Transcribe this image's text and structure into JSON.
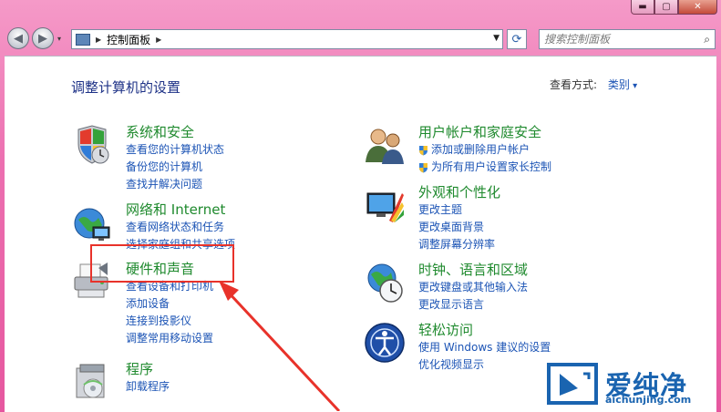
{
  "window": {
    "caption_min": "▬",
    "caption_max": "▢",
    "caption_close": "✕"
  },
  "nav": {
    "back_glyph": "◀",
    "forward_glyph": "▶",
    "breadcrumb": "控制面板",
    "search_placeholder": "搜索控制面板",
    "refresh_glyph": "⟳",
    "search_glyph": "⌕"
  },
  "content": {
    "title": "调整计算机的设置",
    "view_by_label": "查看方式:",
    "view_by_value": "类别"
  },
  "categories": [
    {
      "title": "系统和安全",
      "icon": "system-security-icon",
      "links": [
        "查看您的计算机状态",
        "备份您的计算机",
        "查找并解决问题"
      ]
    },
    {
      "title": "网络和 Internet",
      "icon": "network-icon",
      "links": [
        "查看网络状态和任务",
        "选择家庭组和共享选项"
      ]
    },
    {
      "title": "硬件和声音",
      "icon": "hardware-sound-icon",
      "links": [
        "查看设备和打印机",
        "添加设备",
        "连接到投影仪",
        "调整常用移动设置"
      ]
    },
    {
      "title": "程序",
      "icon": "programs-icon",
      "links": [
        "卸载程序"
      ]
    },
    {
      "title": "用户帐户和家庭安全",
      "icon": "user-accounts-icon",
      "links": [
        "添加或删除用户帐户",
        "为所有用户设置家长控制"
      ]
    },
    {
      "title": "外观和个性化",
      "icon": "appearance-icon",
      "links": [
        "更改主题",
        "更改桌面背景",
        "调整屏幕分辨率"
      ]
    },
    {
      "title": "时钟、语言和区域",
      "icon": "clock-region-icon",
      "links": [
        "更改键盘或其他输入法",
        "更改显示语言"
      ]
    },
    {
      "title": "轻松访问",
      "icon": "ease-of-access-icon",
      "links": [
        "使用 Windows 建议的设置",
        "优化视频显示"
      ]
    }
  ],
  "watermark": {
    "text": "爱纯净",
    "url": "aichunjing.com"
  },
  "colors": {
    "frame": "#e6579f",
    "title": "#1e3287",
    "category": "#1f8a2e",
    "link": "#1c54b5",
    "highlight": "#e8322a"
  }
}
